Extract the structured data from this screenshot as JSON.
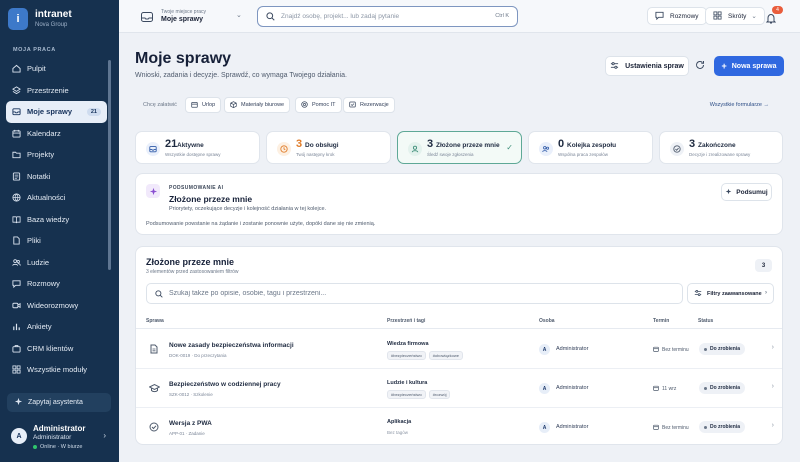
{
  "brand": {
    "logo_letter": "i",
    "name": "intranet",
    "org": "Nova Group"
  },
  "sidebar": {
    "section_label": "MOJA PRACA",
    "items": [
      {
        "label": "Pulpit",
        "icon": "home-icon"
      },
      {
        "label": "Przestrzenie",
        "icon": "layers-icon"
      },
      {
        "label": "Moje sprawy",
        "icon": "inbox-icon",
        "badge": "21",
        "active": true
      },
      {
        "label": "Kalendarz",
        "icon": "calendar-icon"
      },
      {
        "label": "Projekty",
        "icon": "folder-icon"
      },
      {
        "label": "Notatki",
        "icon": "note-icon"
      },
      {
        "label": "Aktualności",
        "icon": "globe-icon"
      },
      {
        "label": "Baza wiedzy",
        "icon": "book-icon"
      },
      {
        "label": "Pliki",
        "icon": "file-icon"
      },
      {
        "label": "Ludzie",
        "icon": "people-icon"
      },
      {
        "label": "Rozmowy",
        "icon": "chat-icon"
      },
      {
        "label": "Wideorozmowy",
        "icon": "video-icon"
      },
      {
        "label": "Ankiety",
        "icon": "chart-icon"
      },
      {
        "label": "CRM klientów",
        "icon": "briefcase-icon"
      },
      {
        "label": "Wszystkie moduły",
        "icon": "grid-icon"
      }
    ],
    "assistant_label": "Zapytaj asystenta",
    "user": {
      "initial": "A",
      "name": "Administrator",
      "role": "Administrator",
      "status": "Online · W biurze"
    }
  },
  "topbar": {
    "workspace_label": "Twoje miejsce pracy",
    "workspace_value": "Moje sprawy",
    "search_placeholder": "Znajdź osobę, projekt... lub zadaj pytanie",
    "search_shortcut": "Ctrl K",
    "chat_label": "Rozmowy",
    "shortcuts_label": "Skróty",
    "notifications_count": "4"
  },
  "page": {
    "title": "Moje sprawy",
    "subtitle": "Wnioski, zadania i decyzje. Sprawdź, co wymaga Twojego działania.",
    "settings_label": "Ustawienia spraw",
    "new_label": "Nowa sprawa"
  },
  "quick": {
    "label": "Chcę załatwić",
    "chips": [
      "Urlop",
      "Materiały biurowe",
      "Pomoc IT",
      "Rezerwacje"
    ],
    "all_forms": "Wszystkie formularze"
  },
  "stats": [
    {
      "num": "21",
      "label": "Aktywne",
      "sub": "Wszystkie dostępne sprawy"
    },
    {
      "num": "3",
      "label": "Do obsługi",
      "sub": "Twój następny krok"
    },
    {
      "num": "3",
      "label": "Złożone przeze mnie",
      "sub": "Śledź swoje zgłoszenia"
    },
    {
      "num": "0",
      "label": "Kolejka zespołu",
      "sub": "Wspólna praca zespołów"
    },
    {
      "num": "3",
      "label": "Zakończone",
      "sub": "Decyzje i zrealizowane sprawy"
    }
  ],
  "ai": {
    "kicker": "PODSUMOWANIE AI",
    "title": "Złożone przeze mnie",
    "desc": "Priorytety, oczekujące decyzje i kolejność działania w tej kolejce.",
    "foot": "Podsumowanie powstanie na żądanie i zostanie ponownie użyte, dopóki dane się nie zmienią.",
    "button": "Podsumuj"
  },
  "list": {
    "title": "Złożone przeze mnie",
    "sub": "3 elementów przed zastosowaniem filtrów",
    "count": "3",
    "search_placeholder": "Szukaj także po opisie, osobie, tagu i przestrzeni...",
    "filter_label": "Filtry zaawansowane",
    "columns": {
      "case": "Sprawa",
      "space": "Przestrzeń i tagi",
      "owner": "Osoba",
      "due": "Termin",
      "status": "Status"
    },
    "rows": [
      {
        "name": "Nowe zasady bezpieczeństwa informacji",
        "meta": "DOK-0019 · Do przeczytania",
        "space": "Wiedza firmowa",
        "tags": [
          "#bezpieczeństwo",
          "#obowiązkowe"
        ],
        "owner_initial": "A",
        "owner": "Administrator",
        "due": "Bez terminu",
        "status": "Do zrobienia",
        "icon": "document-icon"
      },
      {
        "name": "Bezpieczeństwo w codziennej pracy",
        "meta": "SZK-0012 · Szkolenie",
        "space": "Ludzie i kultura",
        "tags": [
          "#bezpieczeństwo",
          "#rozwój"
        ],
        "owner_initial": "A",
        "owner": "Administrator",
        "due": "11 wrz",
        "status": "Do zrobienia",
        "icon": "graduation-icon"
      },
      {
        "name": "Wersja z PWA",
        "meta": "APP-01 · Zadanie",
        "space": "Aplikacja",
        "no_tags": "Bez tagów",
        "owner_initial": "A",
        "owner": "Administrator",
        "due": "Bez terminu",
        "status": "Do zrobienia",
        "icon": "check-circle-icon"
      }
    ]
  }
}
